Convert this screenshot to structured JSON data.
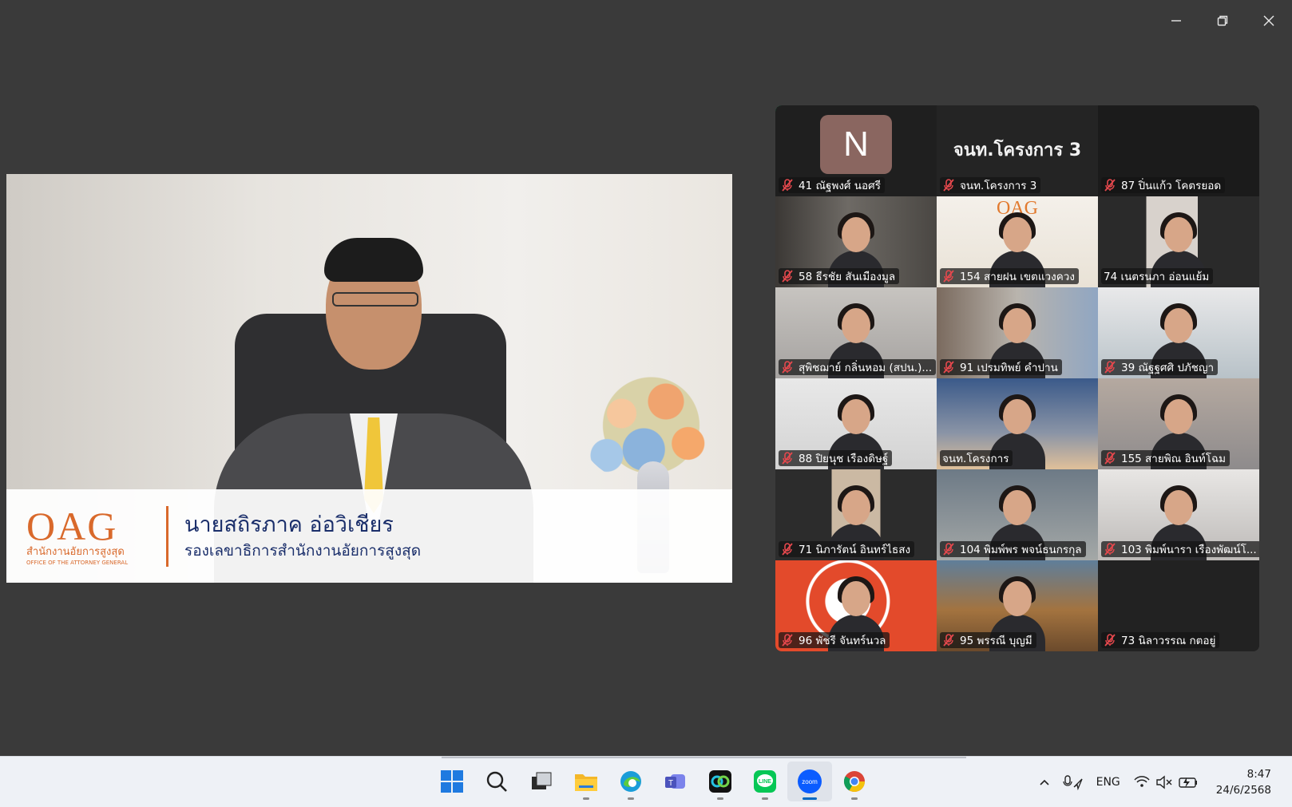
{
  "speaker": {
    "logo_text": "OAG",
    "logo_thai": "สำนักงานอัยการสูงสุด",
    "logo_english": "OFFICE OF THE ATTORNEY GENERAL",
    "name": "นายสถิรภาค  อ่อวิเชียร",
    "role": "รองเลขาธิการสำนักงานอัยการสูงสุด"
  },
  "gallery": {
    "tiles": [
      {
        "label": "41 ณัฐพงศ์ นอศรี",
        "avatar": "N",
        "active": true,
        "muted": true
      },
      {
        "label": "จนท.โครงการ 3",
        "big_name": "จนท.โครงการ 3",
        "muted": true
      },
      {
        "label": "87 ปิ่นแก้ว โคตรยอด",
        "muted": true
      },
      {
        "label": "58 ธีรชัย สันเมืองมูล",
        "muted": true
      },
      {
        "label": "154 สายฝน เขตแวงควง",
        "muted": true,
        "bg_text": "OAG"
      },
      {
        "label": "74 เนตรนภา อ่อนแย้ม",
        "muted": false
      },
      {
        "label": "สุพิชฌาย์ กลิ่นหอม (สปน.)...",
        "muted": true
      },
      {
        "label": "91 เปรมทิพย์ คำปาน",
        "muted": true
      },
      {
        "label": "39 ณัฐฐศศิ ปภัชญา",
        "muted": true
      },
      {
        "label": "88 ปิยนุช เรืองดิษฐ์",
        "muted": true
      },
      {
        "label": "จนท.โครงการ",
        "muted": false
      },
      {
        "label": "155 สายพิณ อินท์โฉม",
        "muted": true
      },
      {
        "label": "71 นิภารัตน์ อินทร์ไธสง",
        "muted": true
      },
      {
        "label": "104 พิมพ์พร พจน์ธนกรกุล",
        "muted": true
      },
      {
        "label": "103 พิมพ์นารา เรืองพัฒน์โ...",
        "muted": true
      },
      {
        "label": "96 พัชรี จันทร์นวล",
        "muted": true
      },
      {
        "label": "95 พรรณี บุญมี",
        "muted": true
      },
      {
        "label": "73 นิลาวรรณ กตอยู่",
        "muted": true
      }
    ]
  },
  "taskbar": {
    "apps": [
      "windows-start",
      "search",
      "task-view",
      "file-explorer",
      "edge",
      "teams",
      "webex",
      "line",
      "zoom",
      "chrome"
    ],
    "zoom_label": "zoom",
    "language": "ENG",
    "time": "8:47",
    "date": "24/6/2568"
  },
  "colors": {
    "background": "#3a3a3a",
    "active_speaker_border": "#1ee07a",
    "mute_icon": "#e5484d",
    "oag_orange": "#d9692b",
    "taskbar": "#eef1f6"
  }
}
